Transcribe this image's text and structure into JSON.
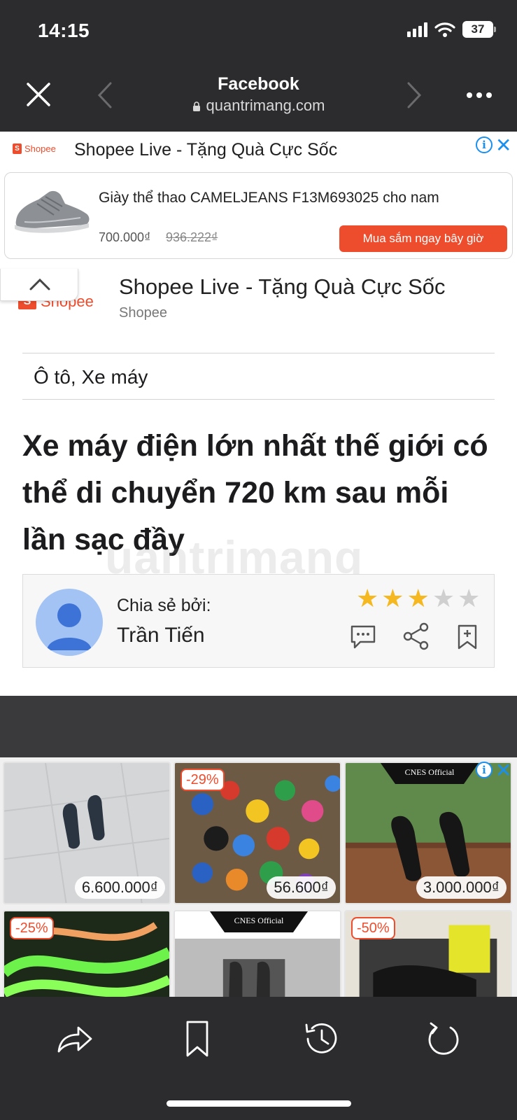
{
  "status_bar": {
    "time": "14:15",
    "battery": "37"
  },
  "browser": {
    "title": "Facebook",
    "url": "quantrimang.com"
  },
  "ad": {
    "mini_brand": "Shopee",
    "title": "Shopee Live - Tặng Quà Cực Sốc",
    "product_name": "Giày thể thao CAMELJEANS F13M693025 cho nam",
    "price": "700.000₫",
    "old_price": "936.222₫",
    "cta": "Mua sắm ngay bây giờ",
    "info_icon": "i",
    "close_icon": "✕"
  },
  "sponsor": {
    "logo_text": "Shopee",
    "title": "Shopee Live - Tặng Quà Cực Sốc",
    "brand": "Shopee"
  },
  "article": {
    "category": "Ô tô, Xe máy",
    "headline": "Xe máy điện lớn nhất thế giới có thể di chuyển 720 km sau mỗi lần sạc đầy",
    "shared_label": "Chia sẻ bởi:",
    "author": "Trần Tiến",
    "rating": 3,
    "rating_max": 5
  },
  "watermark": "uantrimang",
  "products": [
    {
      "price": "6.600.000₫",
      "discount": ""
    },
    {
      "price": "56.600₫",
      "discount": "-29%"
    },
    {
      "price": "3.000.000₫",
      "discount": "",
      "brand": "CNES Official"
    },
    {
      "price": "",
      "discount": "-25%"
    },
    {
      "price": "",
      "discount": "",
      "brand": "CNES Official"
    },
    {
      "price": "",
      "discount": "-50%"
    }
  ],
  "colors": {
    "accent": "#ee4d2d",
    "info": "#1a8ff0",
    "star_on": "#f5b820",
    "star_off": "#cfcfcf"
  }
}
